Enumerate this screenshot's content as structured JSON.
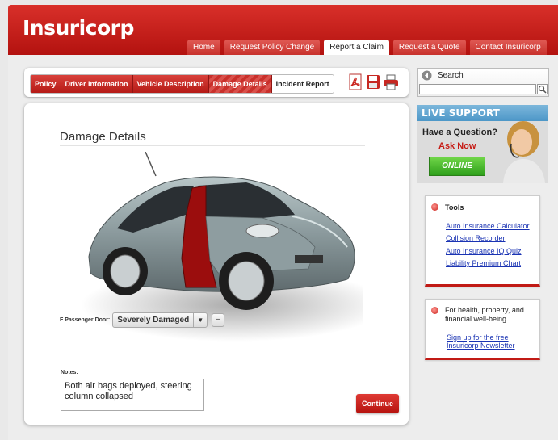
{
  "brand": {
    "name": "Insuricorp",
    "accent": "#c4201b"
  },
  "nav": {
    "tabs": [
      "Home",
      "Request Policy Change",
      "Report a Claim",
      "Request a Quote",
      "Contact Insuricorp"
    ],
    "active": "Report a Claim"
  },
  "claim_tabs": {
    "items": [
      "Policy",
      "Driver Information",
      "Vehicle Description",
      "Damage Details",
      "Incident Report"
    ],
    "active": "Damage Details"
  },
  "doc_icons": [
    "pdf-icon",
    "save-icon",
    "print-icon"
  ],
  "main": {
    "title": "Damage Details",
    "damage_field_label": "F Passenger Door:",
    "damage_value": "Severely Damaged",
    "remove_label": "–",
    "notes_label": "Notes:",
    "notes_value": "Both air bags deployed, steering column collapsed",
    "continue_label": "Continue"
  },
  "search": {
    "label": "Search"
  },
  "live_support": {
    "header": "LIVE SUPPORT",
    "question": "Have a Question?",
    "ask": "Ask Now",
    "online": "ONLINE"
  },
  "tools": {
    "title": "Tools",
    "links": [
      "Auto Insurance Calculator",
      "Collision Recorder",
      "Auto Insurance IQ Quiz",
      "Liability Premium Chart"
    ]
  },
  "newsletter": {
    "text": "For health, property, and financial well-being",
    "link": "Sign up for the free Insuricorp Newsletter"
  }
}
